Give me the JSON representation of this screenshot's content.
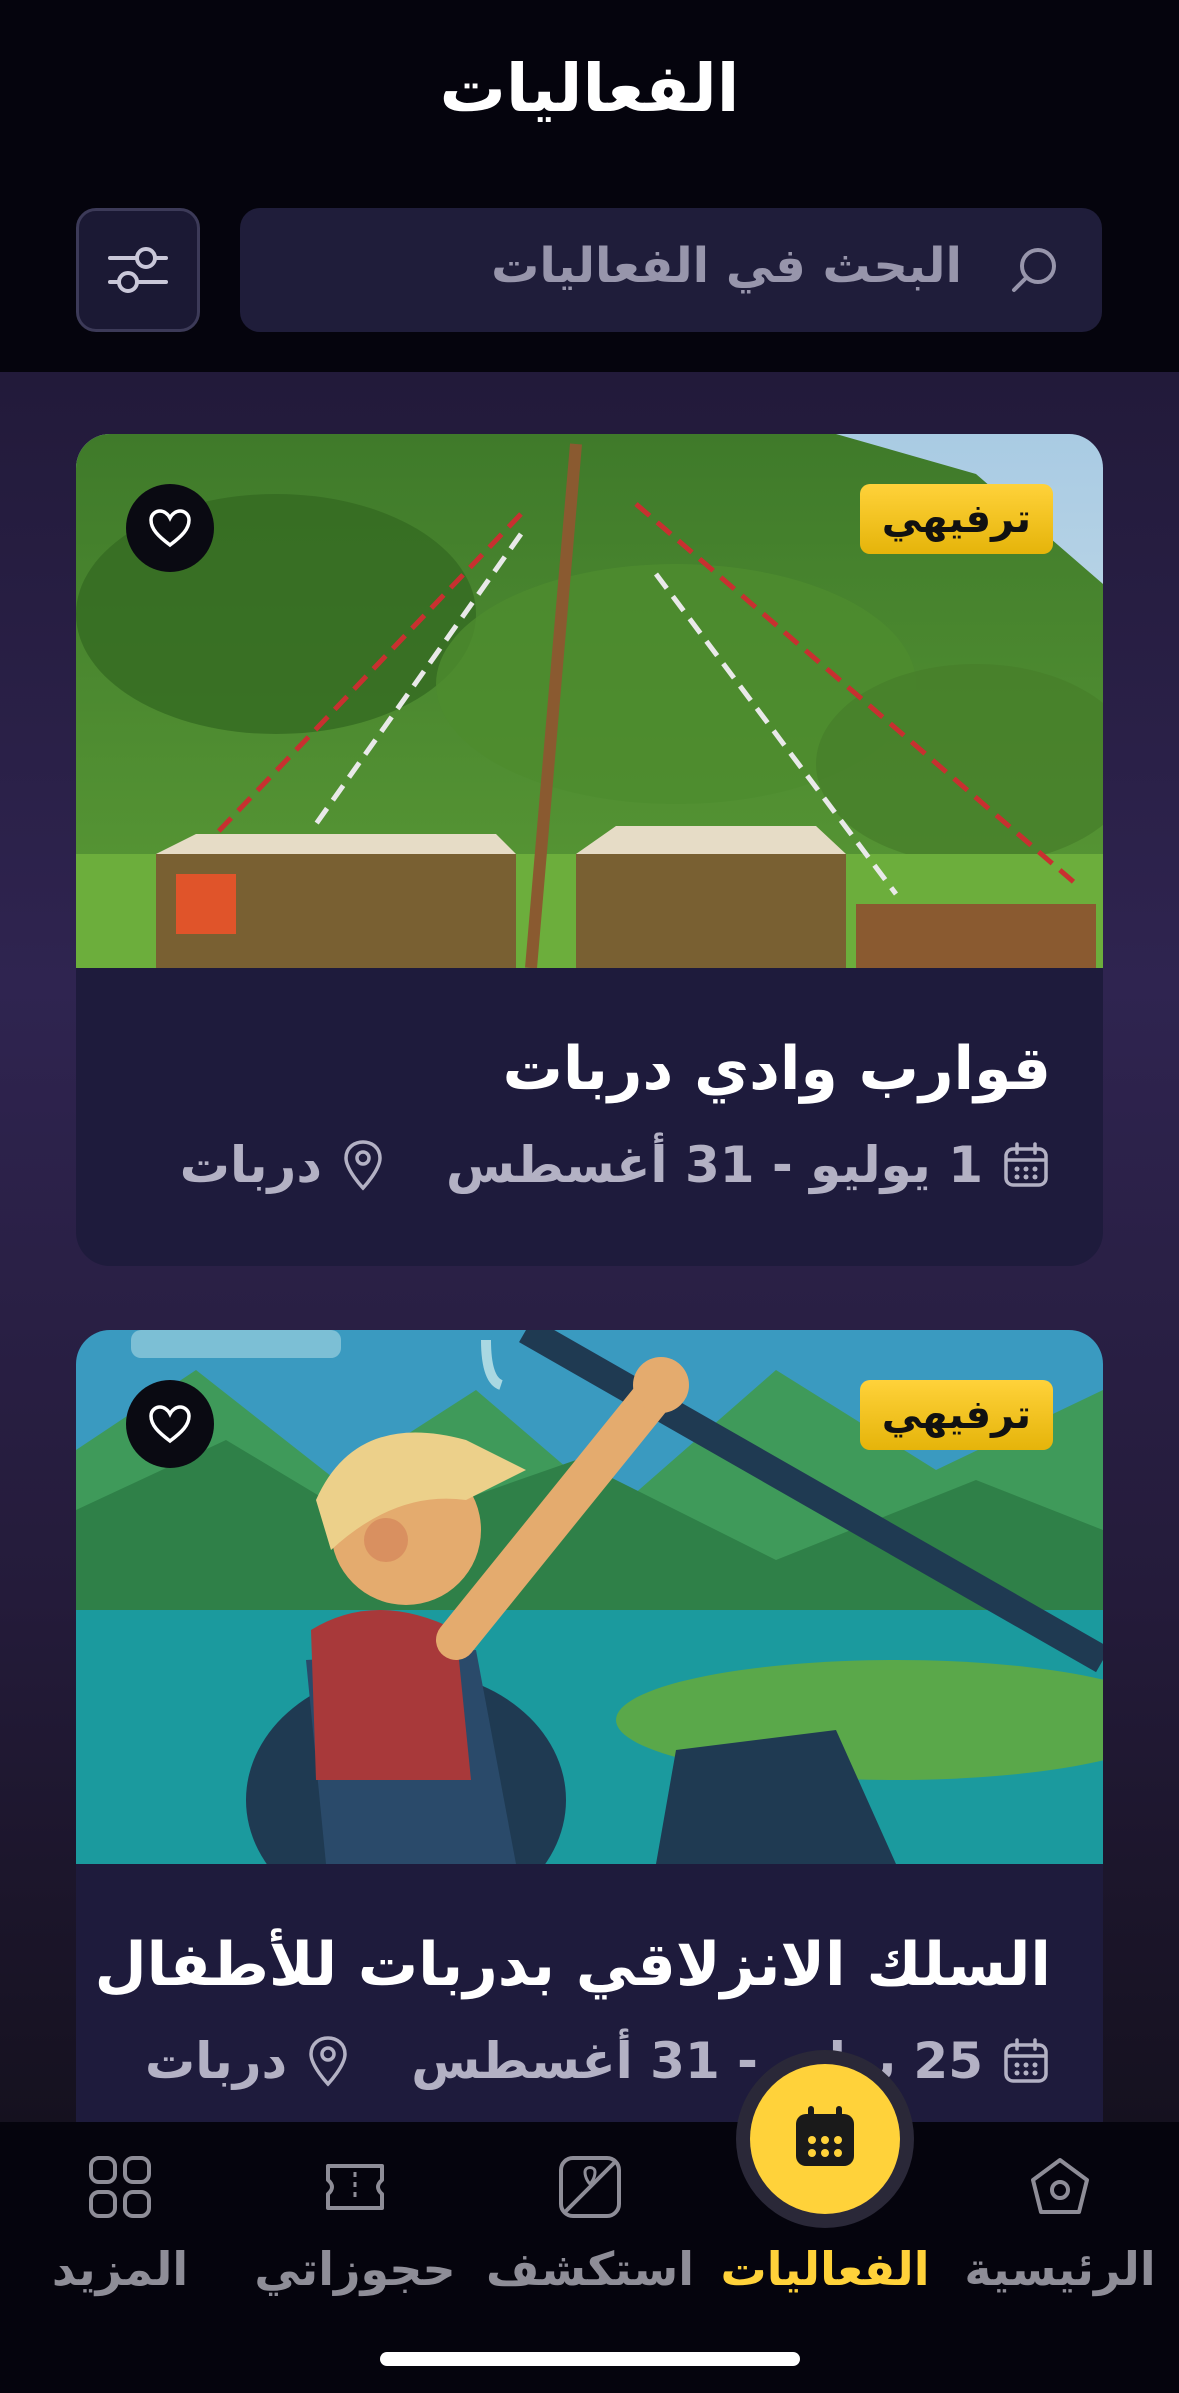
{
  "header": {
    "title": "الفعاليات",
    "search_placeholder": "البحث في الفعاليات"
  },
  "events": [
    {
      "badge": "ترفيهي",
      "title": "قوارب وادي دربات",
      "date": "1 يوليو - 31 أغسطس",
      "location": "دربات",
      "image": "boats-camp-photo"
    },
    {
      "badge": "ترفيهي",
      "title": "السلك الانزلاقي بدربات للأطفال",
      "date": "25 يوليو - 31 أغسطس",
      "location": "دربات",
      "image": "zipline-kid-illustration"
    }
  ],
  "nav": {
    "items": [
      {
        "label": "الرئيسية",
        "icon": "home-icon"
      },
      {
        "label": "الفعاليات",
        "icon": "calendar-icon",
        "active": true
      },
      {
        "label": "استكشف",
        "icon": "map-icon"
      },
      {
        "label": "حجوزاتي",
        "icon": "ticket-icon"
      },
      {
        "label": "المزيد",
        "icon": "grid-icon"
      }
    ]
  },
  "colors": {
    "accent": "#ffd23a",
    "background": "#05040d",
    "card": "#1e1b3c",
    "muted_text": "#b3b1c4"
  }
}
